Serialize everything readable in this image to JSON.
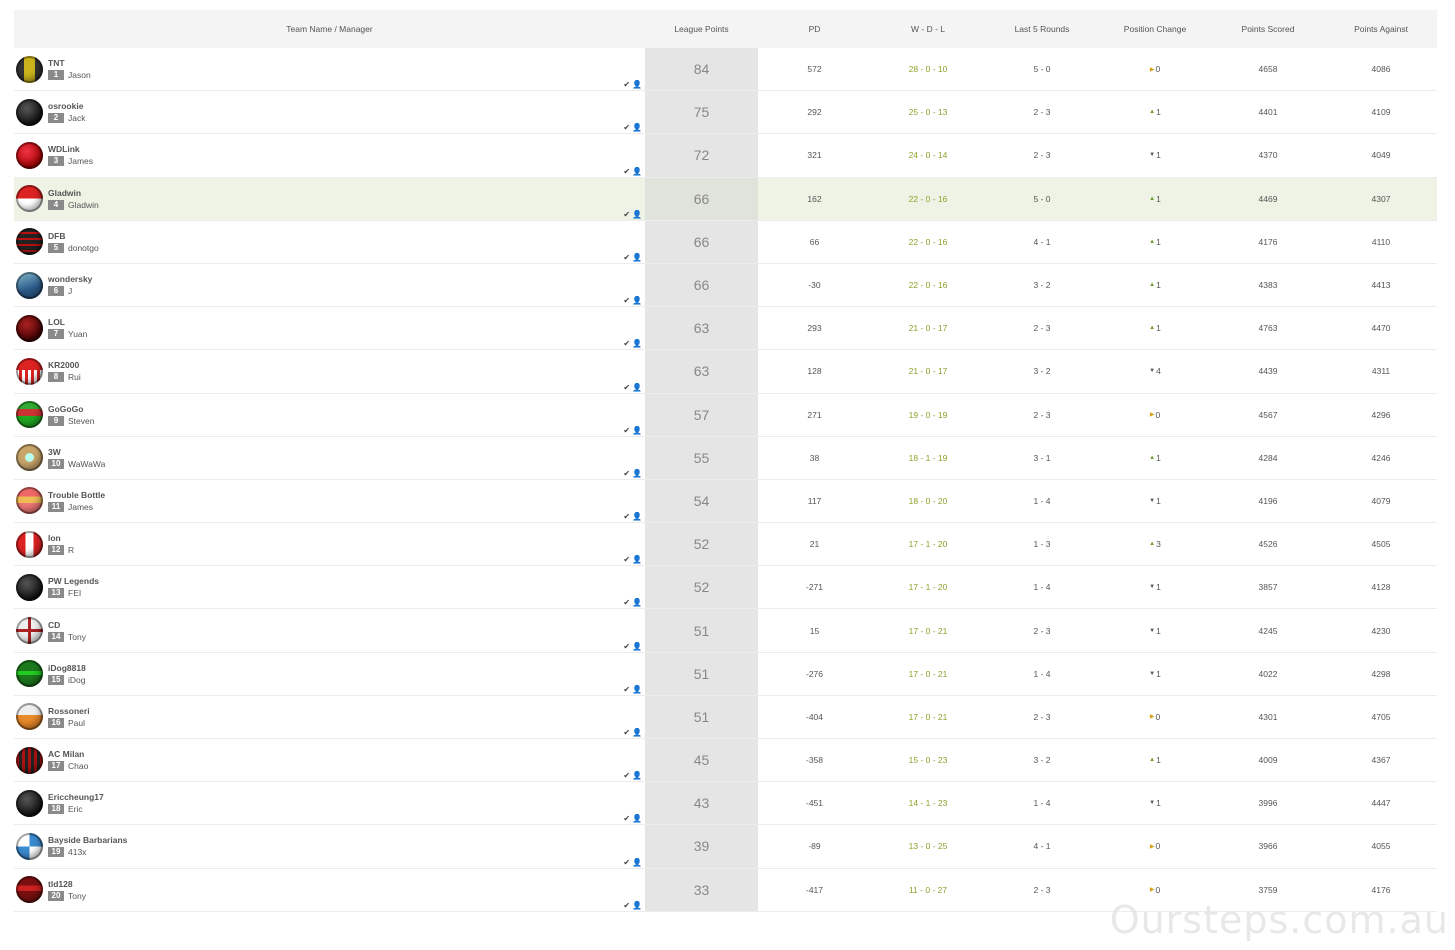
{
  "header": {
    "team": "Team Name / Manager",
    "lp": "League Points",
    "pd": "PD",
    "wdl": "W - D - L",
    "l5": "Last 5 Rounds",
    "pc": "Position Change",
    "ps": "Points Scored",
    "pa": "Points Against"
  },
  "rows": [
    {
      "team": "TNT",
      "rank": "1",
      "manager": "Jason",
      "lp": "84",
      "pd": "572",
      "wdl": "28 - 0 - 10",
      "l5": "5 - 0",
      "pc_dir": "same",
      "pc": "0",
      "ps": "4658",
      "pa": "4086",
      "logo": "yellow-stripe"
    },
    {
      "team": "osrookie",
      "rank": "2",
      "manager": "Jack",
      "lp": "75",
      "pd": "292",
      "wdl": "25 - 0 - 13",
      "l5": "2 - 3",
      "pc_dir": "up",
      "pc": "1",
      "ps": "4401",
      "pa": "4109",
      "logo": "black"
    },
    {
      "team": "WDLink",
      "rank": "3",
      "manager": "James",
      "lp": "72",
      "pd": "321",
      "wdl": "24 - 0 - 14",
      "l5": "2 - 3",
      "pc_dir": "down",
      "pc": "1",
      "ps": "4370",
      "pa": "4049",
      "logo": "red"
    },
    {
      "team": "Gladwin",
      "rank": "4",
      "manager": "Gladwin",
      "lp": "66",
      "pd": "162",
      "wdl": "22 - 0 - 16",
      "l5": "5 - 0",
      "pc_dir": "up",
      "pc": "1",
      "ps": "4469",
      "pa": "4307",
      "logo": "red-white",
      "highlight": true
    },
    {
      "team": "DFB",
      "rank": "5",
      "manager": "donotgo",
      "lp": "66",
      "pd": "66",
      "wdl": "22 - 0 - 16",
      "l5": "4 - 1",
      "pc_dir": "up",
      "pc": "1",
      "ps": "4176",
      "pa": "4110",
      "logo": "black-red-hoops"
    },
    {
      "team": "wondersky",
      "rank": "6",
      "manager": "J",
      "lp": "66",
      "pd": "-30",
      "wdl": "22 - 0 - 16",
      "l5": "3 - 2",
      "pc_dir": "up",
      "pc": "1",
      "ps": "4383",
      "pa": "4413",
      "logo": "blue-chevron"
    },
    {
      "team": "LOL",
      "rank": "7",
      "manager": "Yuan",
      "lp": "63",
      "pd": "293",
      "wdl": "21 - 0 - 17",
      "l5": "2 - 3",
      "pc_dir": "up",
      "pc": "1",
      "ps": "4763",
      "pa": "4470",
      "logo": "dark-red"
    },
    {
      "team": "KR2000",
      "rank": "8",
      "manager": "Rui",
      "lp": "63",
      "pd": "128",
      "wdl": "21 - 0 - 17",
      "l5": "3 - 2",
      "pc_dir": "down",
      "pc": "4",
      "ps": "4439",
      "pa": "4311",
      "logo": "red-stripes"
    },
    {
      "team": "GoGoGo",
      "rank": "9",
      "manager": "Steven",
      "lp": "57",
      "pd": "271",
      "wdl": "19 - 0 - 19",
      "l5": "2 - 3",
      "pc_dir": "same",
      "pc": "0",
      "ps": "4567",
      "pa": "4296",
      "logo": "green-red-v"
    },
    {
      "team": "3W",
      "rank": "10",
      "manager": "WaWaWa",
      "lp": "55",
      "pd": "38",
      "wdl": "18 - 1 - 19",
      "l5": "3 - 1",
      "pc_dir": "up",
      "pc": "1",
      "ps": "4284",
      "pa": "4246",
      "logo": "tan-star"
    },
    {
      "team": "Trouble Bottle",
      "rank": "11",
      "manager": "James",
      "lp": "54",
      "pd": "117",
      "wdl": "18 - 0 - 20",
      "l5": "1 - 4",
      "pc_dir": "down",
      "pc": "1",
      "ps": "4196",
      "pa": "4079",
      "logo": "pink-chevron"
    },
    {
      "team": "lon",
      "rank": "12",
      "manager": "R",
      "lp": "52",
      "pd": "21",
      "wdl": "17 - 1 - 20",
      "l5": "1 - 3",
      "pc_dir": "up",
      "pc": "3",
      "ps": "4526",
      "pa": "4505",
      "logo": "red-white-vertical"
    },
    {
      "team": "PW Legends",
      "rank": "13",
      "manager": "FEI",
      "lp": "52",
      "pd": "-271",
      "wdl": "17 - 1 - 20",
      "l5": "1 - 4",
      "pc_dir": "down",
      "pc": "1",
      "ps": "3857",
      "pa": "4128",
      "logo": "black"
    },
    {
      "team": "CD",
      "rank": "14",
      "manager": "Tony",
      "lp": "51",
      "pd": "15",
      "wdl": "17 - 0 - 21",
      "l5": "2 - 3",
      "pc_dir": "down",
      "pc": "1",
      "ps": "4245",
      "pa": "4230",
      "logo": "white-red-cross"
    },
    {
      "team": "iDog8818",
      "rank": "15",
      "manager": "iDog",
      "lp": "51",
      "pd": "-276",
      "wdl": "17 - 0 - 21",
      "l5": "1 - 4",
      "pc_dir": "down",
      "pc": "1",
      "ps": "4022",
      "pa": "4298",
      "logo": "green-v"
    },
    {
      "team": "Rossoneri",
      "rank": "16",
      "manager": "Paul",
      "lp": "51",
      "pd": "-404",
      "wdl": "17 - 0 - 21",
      "l5": "2 - 3",
      "pc_dir": "same",
      "pc": "0",
      "ps": "4301",
      "pa": "4705",
      "logo": "orange-white"
    },
    {
      "team": "AC Milan",
      "rank": "17",
      "manager": "Chao",
      "lp": "45",
      "pd": "-358",
      "wdl": "15 - 0 - 23",
      "l5": "3 - 2",
      "pc_dir": "up",
      "pc": "1",
      "ps": "4009",
      "pa": "4367",
      "logo": "red-black-stripes"
    },
    {
      "team": "Ericcheung17",
      "rank": "18",
      "manager": "Eric",
      "lp": "43",
      "pd": "-451",
      "wdl": "14 - 1 - 23",
      "l5": "1 - 4",
      "pc_dir": "down",
      "pc": "1",
      "ps": "3996",
      "pa": "4447",
      "logo": "black"
    },
    {
      "team": "Bayside Barbarians",
      "rank": "19",
      "manager": "413x",
      "lp": "39",
      "pd": "-89",
      "wdl": "13 - 0 - 25",
      "l5": "4 - 1",
      "pc_dir": "same",
      "pc": "0",
      "ps": "3966",
      "pa": "4055",
      "logo": "blue-white-quarters"
    },
    {
      "team": "tld128",
      "rank": "20",
      "manager": "Tony",
      "lp": "33",
      "pd": "-417",
      "wdl": "11 - 0 - 27",
      "l5": "2 - 3",
      "pc_dir": "same",
      "pc": "0",
      "ps": "3759",
      "pa": "4176",
      "logo": "dark-red-v"
    }
  ],
  "watermark": "Oursteps.com.au",
  "colors": {
    "wdl": "#8aa32a",
    "up": "#6a9a2a",
    "same": "#d8a21c",
    "highlight": "#eef3e6",
    "lp_bg": "#e5e5e6"
  }
}
